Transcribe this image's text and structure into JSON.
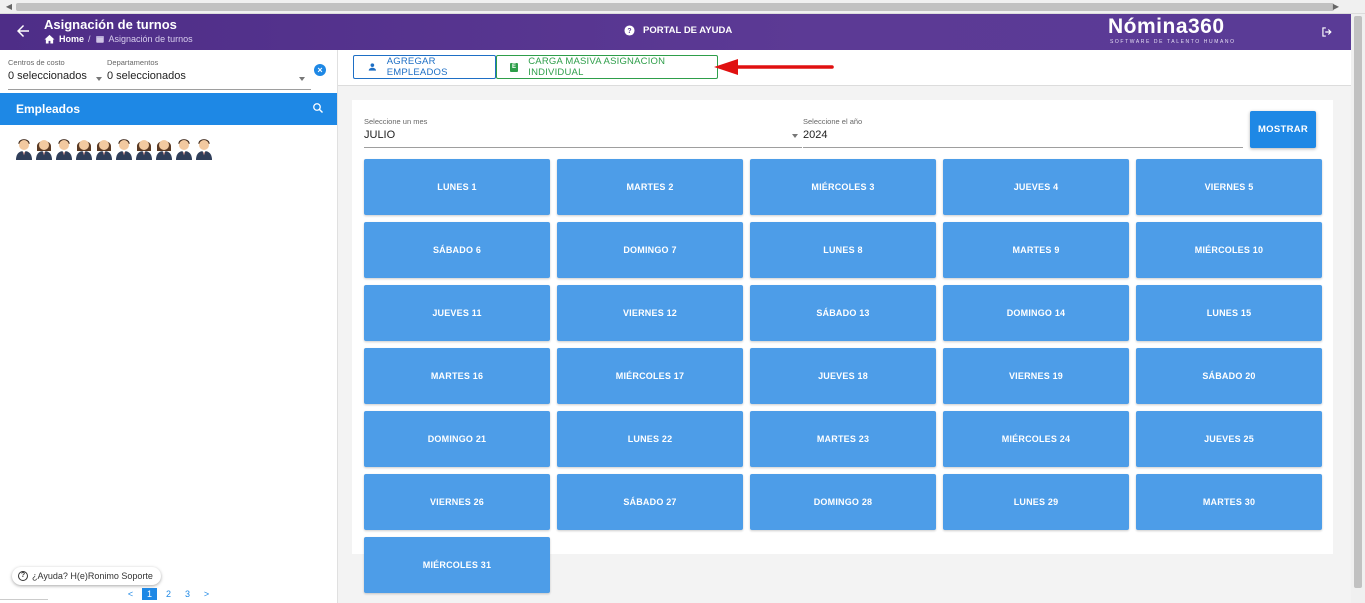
{
  "header": {
    "title": "Asignación de turnos",
    "breadcrumb_home": "Home",
    "breadcrumb_current": "Asignación de turnos",
    "help_label": "PORTAL DE AYUDA",
    "brand": "Nómina360",
    "brand_sub": "SOFTWARE DE TALENTO HUMANO",
    "header_color": "#5a3a95"
  },
  "filters": {
    "cost_centers_label": "Centros de costo",
    "cost_centers_value": "0 seleccionados",
    "departments_label": "Departamentos",
    "departments_value": "0 seleccionados"
  },
  "employees": {
    "header": "Empleados",
    "avatars": [
      "male",
      "female",
      "male",
      "female",
      "female",
      "male",
      "female",
      "female",
      "male",
      "male"
    ]
  },
  "help_chip": "¿Ayuda? H(e)Ronimo Soporte",
  "pager": {
    "prev": "<",
    "pages": [
      "1",
      "2",
      "3"
    ],
    "active": "1",
    "next": ">"
  },
  "toolbar": {
    "add_employees": "AGREGAR EMPLEADOS",
    "bulk_upload": "CARGA MASIVA ASIGNACION INDIVIDUAL",
    "xls_badge": "E"
  },
  "selectors": {
    "month_label": "Seleccione un mes",
    "month_value": "JULIO",
    "year_label": "Seleccione el año",
    "year_value": "2024",
    "show_button": "MOSTRAR"
  },
  "days": [
    "LUNES 1",
    "MARTES 2",
    "MIÉRCOLES 3",
    "JUEVES 4",
    "VIERNES 5",
    "SÁBADO 6",
    "DOMINGO 7",
    "LUNES 8",
    "MARTES 9",
    "MIÉRCOLES 10",
    "JUEVES 11",
    "VIERNES 12",
    "SÁBADO 13",
    "DOMINGO 14",
    "LUNES 15",
    "MARTES 16",
    "MIÉRCOLES 17",
    "JUEVES 18",
    "VIERNES 19",
    "SÁBADO 20",
    "DOMINGO 21",
    "LUNES 22",
    "MARTES 23",
    "MIÉRCOLES 24",
    "JUEVES 25",
    "VIERNES 26",
    "SÁBADO 27",
    "DOMINGO 28",
    "LUNES 29",
    "MARTES 30",
    "MIÉRCOLES 31"
  ],
  "colors": {
    "primary": "#1e88e5",
    "day_button": "#4d9de8",
    "bulk_green": "#2e9e4a",
    "annotation_arrow": "#e01010"
  }
}
